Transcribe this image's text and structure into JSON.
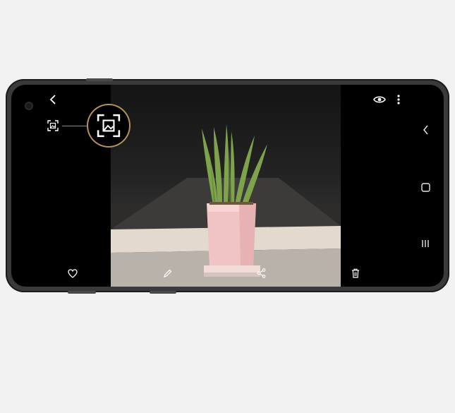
{
  "screen": {
    "top_bar": {
      "back_icon": "chevron-left-icon",
      "eye_icon": "eye-icon",
      "more_icon": "more-vertical-icon"
    },
    "scene_optimizer": {
      "small_icon": "scan-image-icon",
      "highlight_icon": "scan-image-icon",
      "highlight_ring_color": "#b4925a"
    },
    "photo": {
      "subject": "potted-plant",
      "pot_color": "#f0c4c4",
      "leaf_color": "#7fa34a"
    },
    "bottom_bar": {
      "favorite_icon": "heart-icon",
      "edit_icon": "pencil-icon",
      "share_icon": "share-icon",
      "delete_icon": "trash-icon"
    },
    "nav_bar": {
      "back_icon": "chevron-left-icon",
      "home_icon": "home-square-icon",
      "recents_icon": "recents-lines-icon"
    }
  }
}
